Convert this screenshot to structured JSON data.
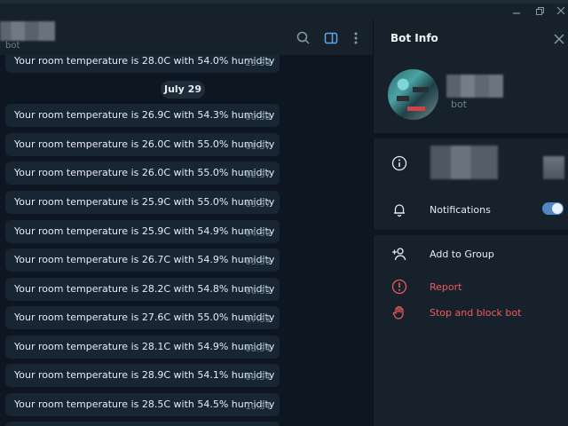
{
  "chat": {
    "subtitle": "bot",
    "date_label": "July 29",
    "messages": [
      {
        "text": "Your room temperature is 28.0C with 54.0% humidity",
        "time": "23.38"
      },
      {
        "text": "Your room temperature is 26.9C with 54.3% humidity",
        "time": "00.38"
      },
      {
        "text": "Your room temperature is 26.0C with 55.0% humidity",
        "time": "01.37"
      },
      {
        "text": "Your room temperature is 26.0C with 55.0% humidity",
        "time": "02.37"
      },
      {
        "text": "Your room temperature is 25.9C with 55.0% humidity",
        "time": "03.37"
      },
      {
        "text": "Your room temperature is 25.9C with 54.9% humidity",
        "time": "04.36"
      },
      {
        "text": "Your room temperature is 26.7C with 54.9% humidity",
        "time": "05.36"
      },
      {
        "text": "Your room temperature is 28.2C with 54.8% humidity",
        "time": "06.35"
      },
      {
        "text": "Your room temperature is 27.6C with 55.0% humidity",
        "time": "07.35"
      },
      {
        "text": "Your room temperature is 28.1C with 54.9% humidity",
        "time": "08.34"
      },
      {
        "text": "Your room temperature is 28.9C with 54.1% humidity",
        "time": "09.34"
      },
      {
        "text": "Your room temperature is 28.5C with 54.5% humidity",
        "time": "10.34"
      }
    ]
  },
  "panel": {
    "title": "Bot Info",
    "subtitle": "bot",
    "notifications_label": "Notifications",
    "notifications_on": true,
    "add_to_group_label": "Add to Group",
    "report_label": "Report",
    "stop_block_label": "Stop and block bot"
  },
  "colors": {
    "background": "#0e1621",
    "panel": "#17212b",
    "bubble": "#182533",
    "accent": "#5288c1",
    "danger": "#ef5b5b"
  },
  "icons": {
    "header": [
      "search-icon",
      "sidebar-toggle-icon",
      "more-vertical-icon"
    ],
    "panel": [
      "close-icon",
      "info-icon",
      "bell-icon",
      "add-user-icon",
      "report-icon",
      "stop-hand-icon"
    ]
  }
}
